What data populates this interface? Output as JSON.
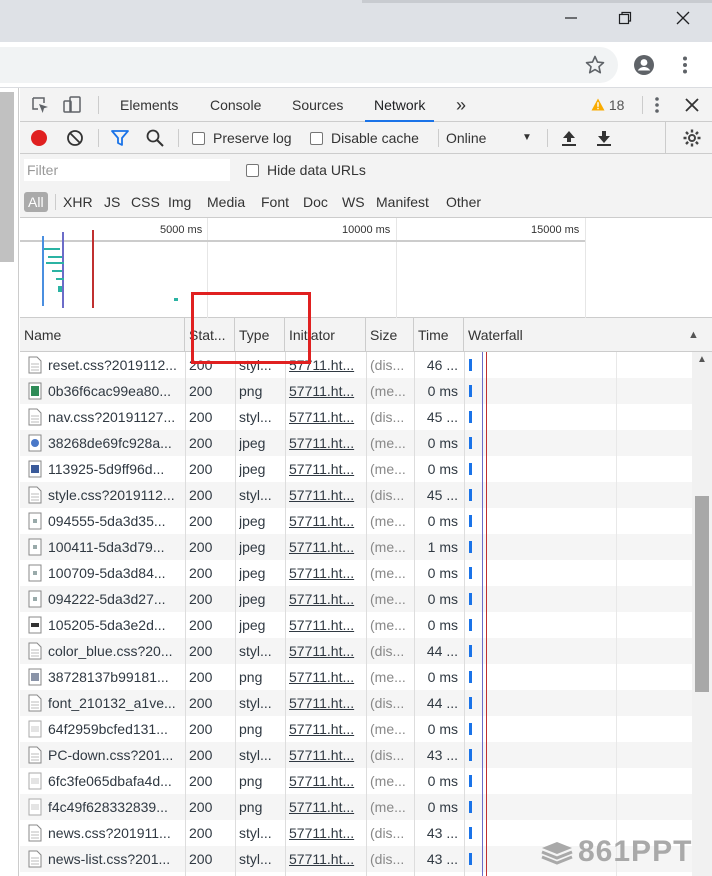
{
  "devtools": {
    "tabs": [
      "Elements",
      "Console",
      "Sources",
      "Network"
    ],
    "active_tab": "Network",
    "more_tabs_symbol": "»",
    "warnings_count": "18"
  },
  "toolbar": {
    "preserve_log": "Preserve log",
    "disable_cache": "Disable cache",
    "throttling": "Online"
  },
  "filter": {
    "placeholder": "Filter",
    "hide_data_urls": "Hide data URLs"
  },
  "resource_types": [
    "All",
    "XHR",
    "JS",
    "CSS",
    "Img",
    "Media",
    "Font",
    "Doc",
    "WS",
    "Manifest",
    "Other"
  ],
  "overview": {
    "ticks": [
      "5000 ms",
      "10000 ms",
      "15000 ms"
    ]
  },
  "columns": [
    "Name",
    "Stat...",
    "Type",
    "Initiator",
    "Size",
    "Time",
    "Waterfall"
  ],
  "rows": [
    {
      "name": "reset.css?2019112...",
      "status": "200",
      "type": "styl...",
      "initiator": "57711.ht...",
      "size": "(dis...",
      "time": "46 ...",
      "icon": "doc"
    },
    {
      "name": "0b36f6cac99ea80...",
      "status": "200",
      "type": "png",
      "initiator": "57711.ht...",
      "size": "(me...",
      "time": "0 ms",
      "icon": "img-green"
    },
    {
      "name": "nav.css?20191127...",
      "status": "200",
      "type": "styl...",
      "initiator": "57711.ht...",
      "size": "(dis...",
      "time": "45 ...",
      "icon": "doc"
    },
    {
      "name": "38268de69fc928a...",
      "status": "200",
      "type": "jpeg",
      "initiator": "57711.ht...",
      "size": "(me...",
      "time": "0 ms",
      "icon": "img-blue"
    },
    {
      "name": "113925-5d9ff96d...",
      "status": "200",
      "type": "jpeg",
      "initiator": "57711.ht...",
      "size": "(me...",
      "time": "0 ms",
      "icon": "img-navy"
    },
    {
      "name": "style.css?2019112...",
      "status": "200",
      "type": "styl...",
      "initiator": "57711.ht...",
      "size": "(dis...",
      "time": "45 ...",
      "icon": "doc"
    },
    {
      "name": "094555-5da3d35...",
      "status": "200",
      "type": "jpeg",
      "initiator": "57711.ht...",
      "size": "(me...",
      "time": "0 ms",
      "icon": "img-small"
    },
    {
      "name": "100411-5da3d79...",
      "status": "200",
      "type": "jpeg",
      "initiator": "57711.ht...",
      "size": "(me...",
      "time": "1 ms",
      "icon": "img-small"
    },
    {
      "name": "100709-5da3d84...",
      "status": "200",
      "type": "jpeg",
      "initiator": "57711.ht...",
      "size": "(me...",
      "time": "0 ms",
      "icon": "img-small"
    },
    {
      "name": "094222-5da3d27...",
      "status": "200",
      "type": "jpeg",
      "initiator": "57711.ht...",
      "size": "(me...",
      "time": "0 ms",
      "icon": "img-small"
    },
    {
      "name": "105205-5da3e2d...",
      "status": "200",
      "type": "jpeg",
      "initiator": "57711.ht...",
      "size": "(me...",
      "time": "0 ms",
      "icon": "img-dark"
    },
    {
      "name": "color_blue.css?20...",
      "status": "200",
      "type": "styl...",
      "initiator": "57711.ht...",
      "size": "(dis...",
      "time": "44 ...",
      "icon": "doc"
    },
    {
      "name": "38728137b99181...",
      "status": "200",
      "type": "png",
      "initiator": "57711.ht...",
      "size": "(me...",
      "time": "0 ms",
      "icon": "img-grey"
    },
    {
      "name": "font_210132_a1ve...",
      "status": "200",
      "type": "styl...",
      "initiator": "57711.ht...",
      "size": "(dis...",
      "time": "44 ...",
      "icon": "doc"
    },
    {
      "name": "64f2959bcfed131...",
      "status": "200",
      "type": "png",
      "initiator": "57711.ht...",
      "size": "(me...",
      "time": "0 ms",
      "icon": "img-faint"
    },
    {
      "name": "PC-down.css?201...",
      "status": "200",
      "type": "styl...",
      "initiator": "57711.ht...",
      "size": "(dis...",
      "time": "43 ...",
      "icon": "doc"
    },
    {
      "name": "6fc3fe065dbafa4d...",
      "status": "200",
      "type": "png",
      "initiator": "57711.ht...",
      "size": "(me...",
      "time": "0 ms",
      "icon": "img-faint"
    },
    {
      "name": "f4c49f628332839...",
      "status": "200",
      "type": "png",
      "initiator": "57711.ht...",
      "size": "(me...",
      "time": "0 ms",
      "icon": "img-faint"
    },
    {
      "name": "news.css?201911...",
      "status": "200",
      "type": "styl...",
      "initiator": "57711.ht...",
      "size": "(dis...",
      "time": "43 ...",
      "icon": "doc"
    },
    {
      "name": "news-list.css?201...",
      "status": "200",
      "type": "styl...",
      "initiator": "57711.ht...",
      "size": "(dis...",
      "time": "43 ...",
      "icon": "doc"
    }
  ],
  "watermark": "861PPT",
  "colors": {
    "record": "#e02020",
    "accent": "#1a73e8",
    "warning": "#f9ab00",
    "highlight_box": "#e02020"
  }
}
